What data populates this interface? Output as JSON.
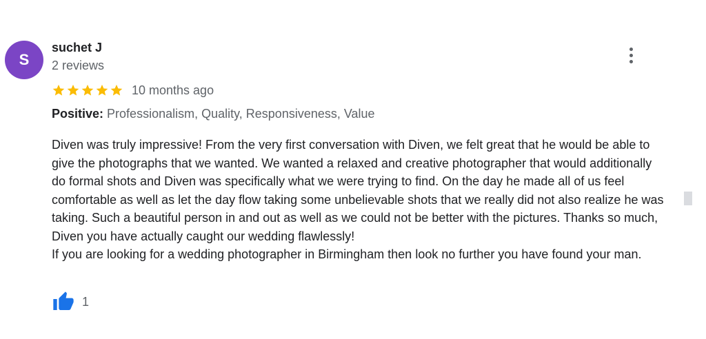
{
  "reviewer": {
    "initial": "S",
    "name": "suchet J",
    "review_count": "2 reviews",
    "avatar_color": "#7b45c5"
  },
  "rating": {
    "stars": 5,
    "max_stars": 5,
    "star_color": "#fbbc04",
    "time_ago": "10 months ago"
  },
  "attributes": {
    "label": "Positive:",
    "value": "Professionalism, Quality, Responsiveness, Value"
  },
  "review": {
    "paragraph1": "Diven was truly impressive! From the very first conversation with Diven, we felt great that he would be able to give the photographs that we wanted. We wanted a relaxed and creative photographer that would additionally do formal shots and Diven was specifically what we were trying to find. On the day he made all of us feel comfortable as well as let the day flow taking some unbelievable shots that we really did not also realize he was taking. Such a beautiful person in and out as well as we could not be better with the pictures. Thanks so much, Diven you have actually caught our wedding flawlessly!",
    "paragraph2": "If you are looking for a wedding photographer in Birmingham then look no further you have found your man."
  },
  "likes": {
    "count": "1",
    "icon": "thumbs-up-icon",
    "icon_color": "#1a73e8"
  },
  "menu": {
    "icon": "more-vert-icon"
  }
}
